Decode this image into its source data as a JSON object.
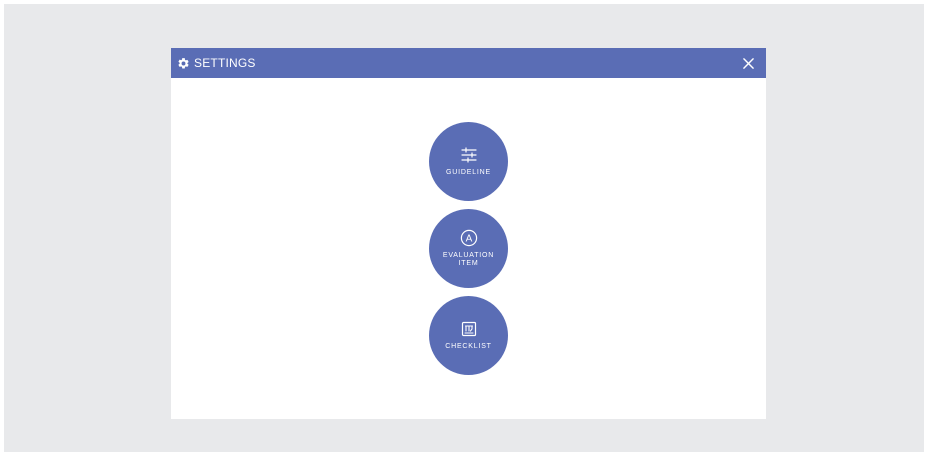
{
  "dialog": {
    "title": "SETTINGS",
    "title_icon": "gear-icon",
    "close_icon": "close-icon",
    "close_glyph": "✕"
  },
  "buttons": [
    {
      "label": "GUIDELINE",
      "icon": "sliders-icon"
    },
    {
      "label_line1": "EVALUATION",
      "label_line2": "ITEM",
      "icon": "circled-a-icon",
      "icon_text": "A"
    },
    {
      "label": "CHECKLIST",
      "icon": "checklist-icon"
    }
  ],
  "colors": {
    "accent": "#5a6db5",
    "background": "#e8e9eb",
    "surface": "#ffffff"
  }
}
